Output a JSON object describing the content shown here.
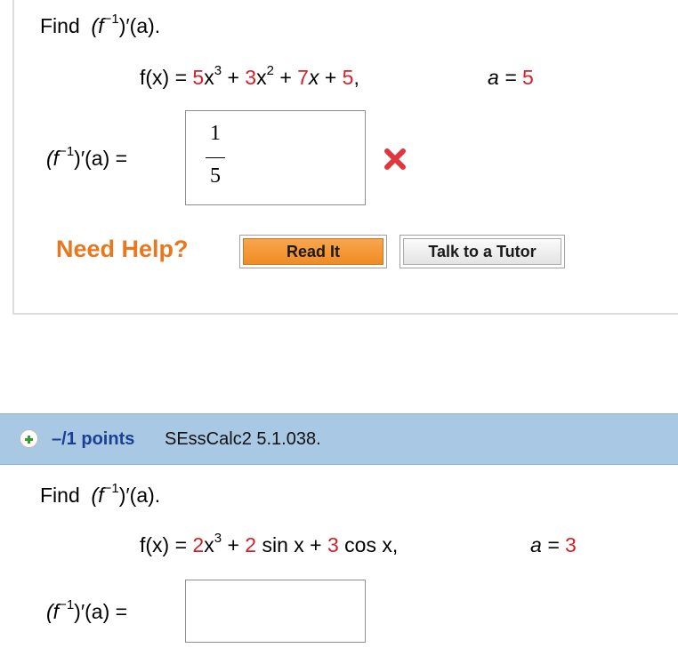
{
  "q1": {
    "prompt_find": "Find",
    "prompt_expr": "(f",
    "prompt_sup": "−1",
    "prompt_tail": ")′(a).",
    "fx_lhs": "f(x) =",
    "fx_c1": "5",
    "fx_x3": "x",
    "fx_sup3": "3",
    "fx_plus1": "+",
    "fx_c2": "3",
    "fx_x2": "x",
    "fx_sup2": "2",
    "fx_plus2": "+",
    "fx_c3": "7",
    "fx_x": "x",
    "fx_plus3": "+",
    "fx_c4": "5",
    "fx_comma": ",",
    "a_label": "a =",
    "a_value": "5",
    "answer_label_pre": "(f",
    "answer_label_sup": "−1",
    "answer_label_post": ")′(a)  =",
    "answer_num": "1",
    "answer_den": "5",
    "answer_status": "incorrect",
    "status_icon": "x-icon",
    "status_color": "#e0363f"
  },
  "help": {
    "label": "Need Help?",
    "read_it": "Read It",
    "talk_tutor": "Talk to a Tutor"
  },
  "q2_header": {
    "points": "–/1 points",
    "code": "SEssCalc2 5.1.038."
  },
  "q2": {
    "prompt_find": "Find",
    "prompt_expr": "(f",
    "prompt_sup": "−1",
    "prompt_tail": ")′(a).",
    "fx_lhs": "f(x) =",
    "fx_c1": "2",
    "fx_x3": "x",
    "fx_sup3": "3",
    "fx_plus1": "+",
    "fx_c2": "2",
    "fx_sin": "sin x",
    "fx_plus2": "+",
    "fx_c3": "3",
    "fx_cos": "cos x,",
    "a_label": "a =",
    "a_value": "3",
    "answer_label_pre": "(f",
    "answer_label_sup": "−1",
    "answer_label_post": ")′(a)  =",
    "answer_value": ""
  },
  "colors": {
    "accent_red": "#d4202a",
    "help_orange": "#e8781f",
    "header_blue": "#a9c8e4",
    "points_blue": "#1c3f94"
  }
}
